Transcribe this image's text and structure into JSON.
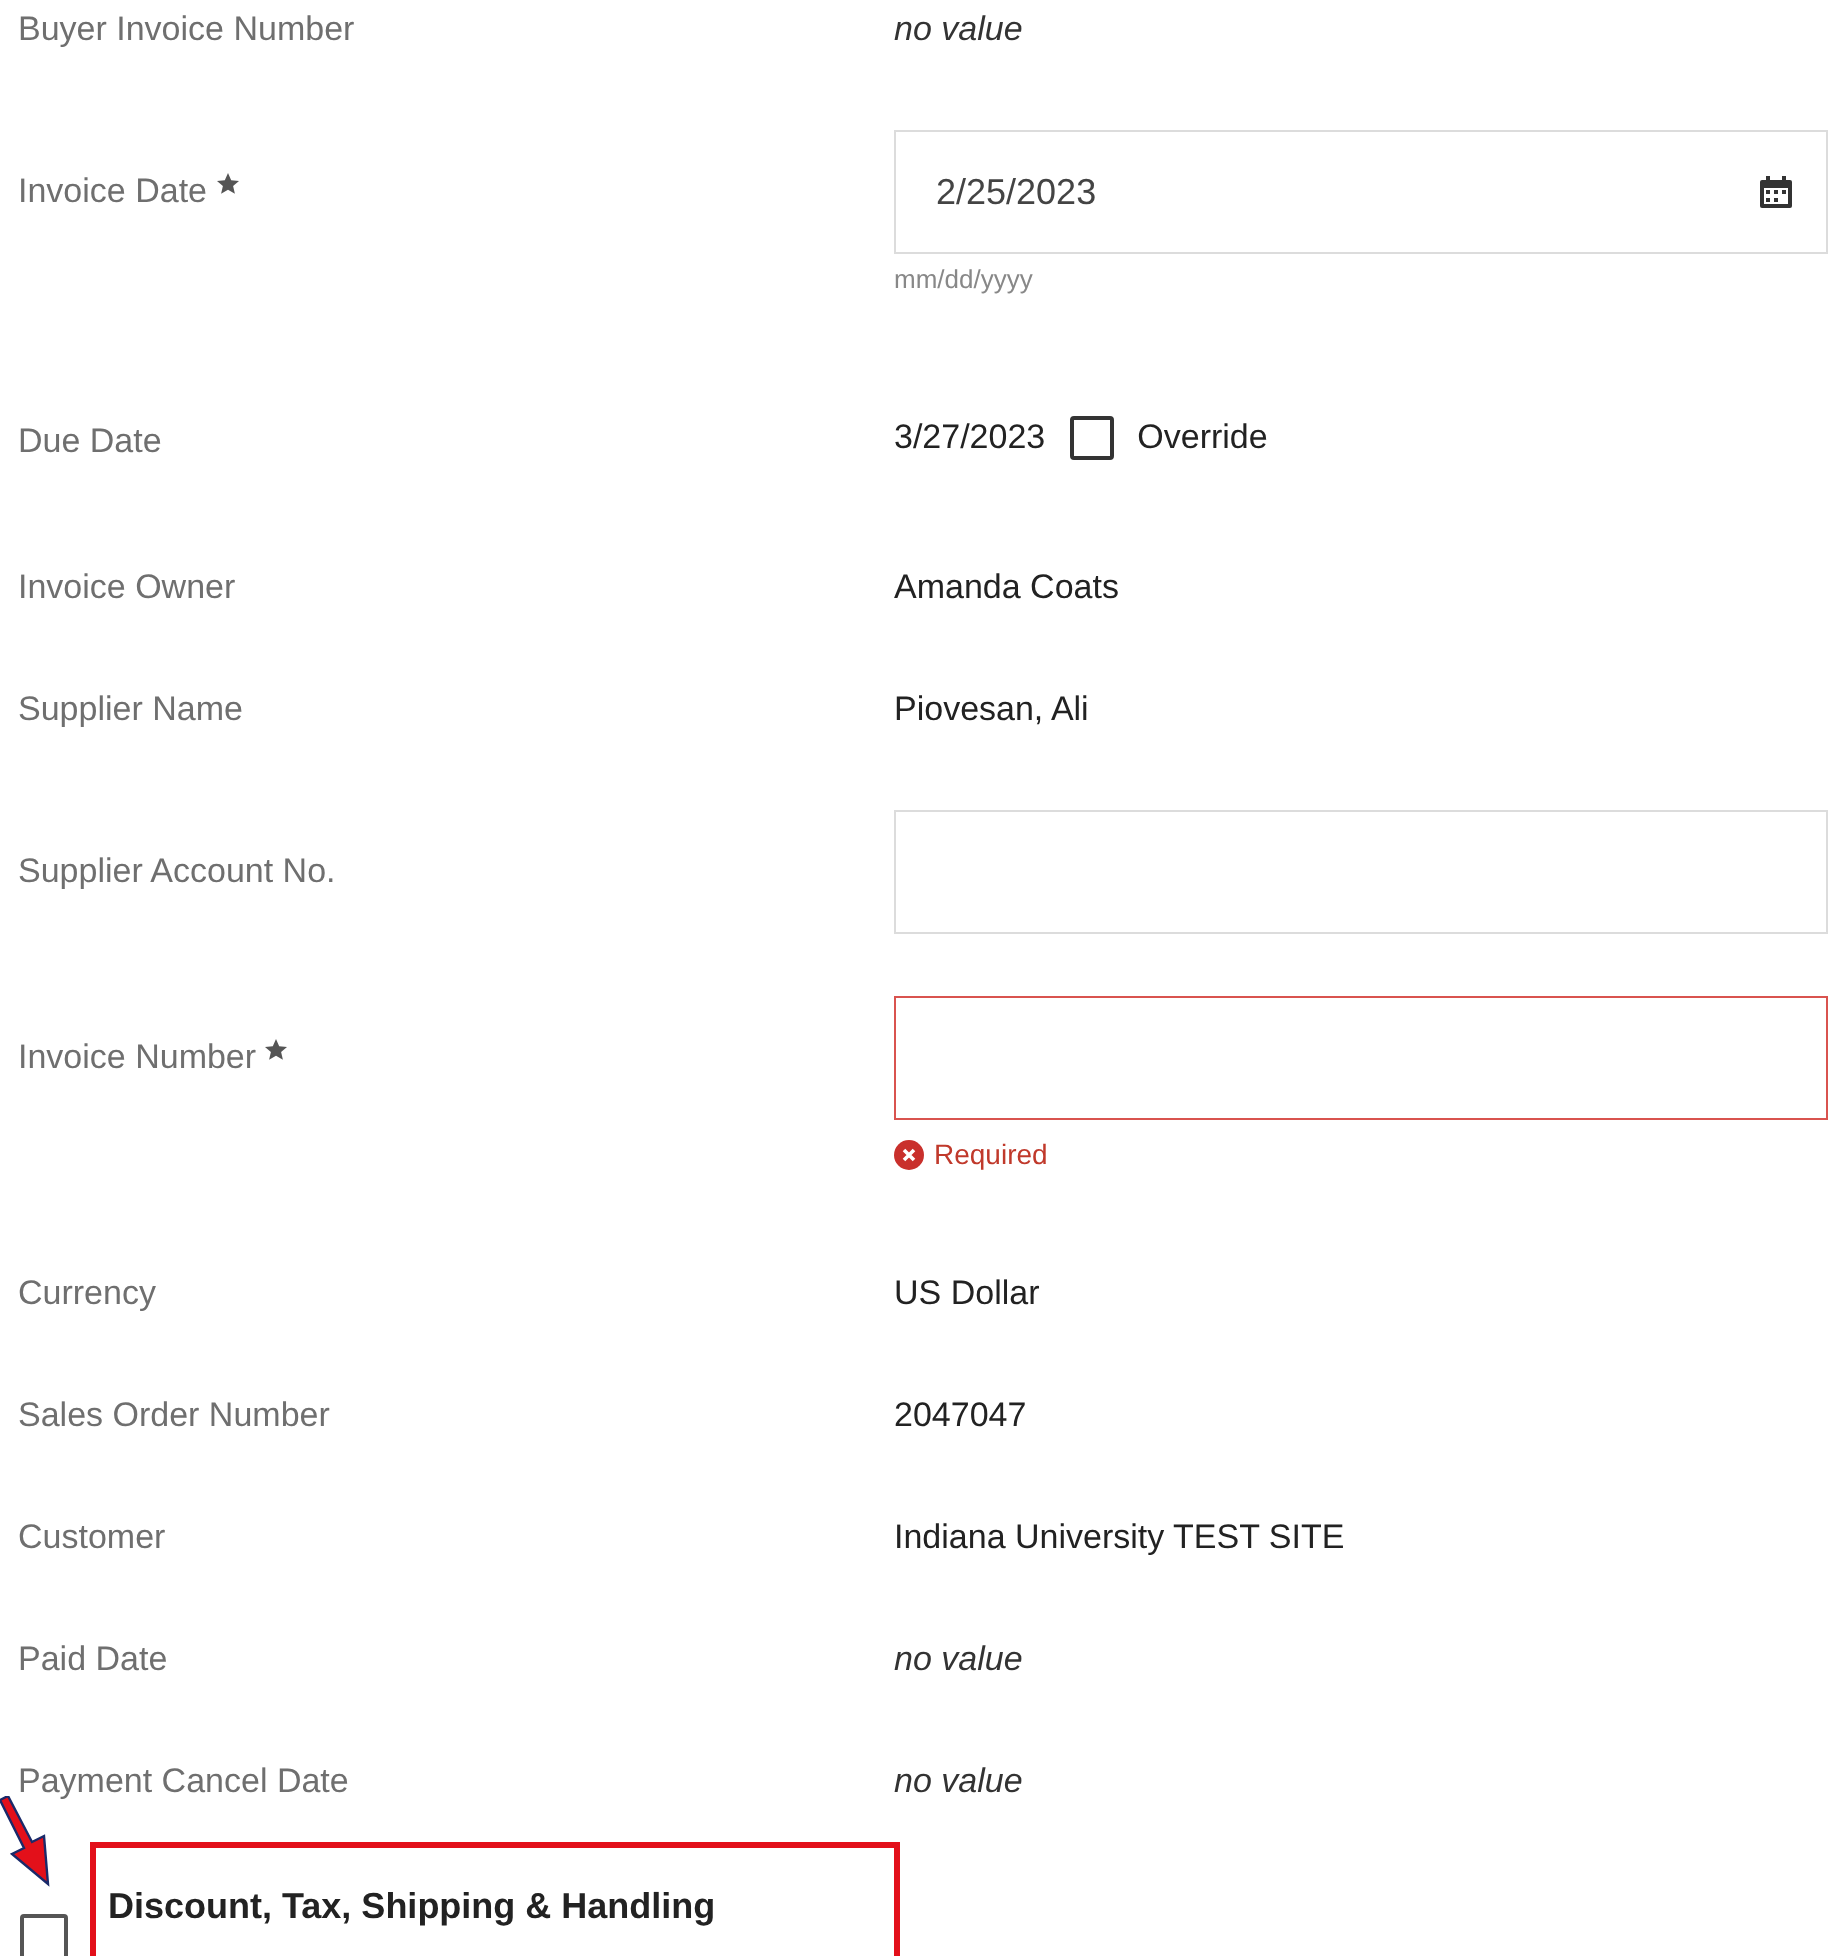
{
  "fields": [
    {
      "kind": "text",
      "label": "Buyer Invoice Number",
      "required": false,
      "value": "no value",
      "empty": true
    },
    {
      "kind": "date",
      "label": "Invoice Date",
      "required": true,
      "value": "2/25/2023",
      "hint": "mm/dd/yyyy"
    },
    {
      "kind": "due",
      "label": "Due Date",
      "required": false,
      "value": "3/27/2023",
      "override": {
        "label": "Override",
        "checked": false
      }
    },
    {
      "kind": "text",
      "label": "Invoice Owner",
      "required": false,
      "value": "Amanda Coats",
      "empty": false
    },
    {
      "kind": "text",
      "label": "Supplier Name",
      "required": false,
      "value": "Piovesan, Ali",
      "empty": false
    },
    {
      "kind": "input",
      "label": "Supplier Account No.",
      "required": false,
      "invalid": false
    },
    {
      "kind": "input",
      "label": "Invoice Number",
      "required": true,
      "invalid": true,
      "error": "Required"
    },
    {
      "kind": "text",
      "label": "Currency",
      "required": false,
      "value": "US Dollar",
      "empty": false
    },
    {
      "kind": "text",
      "label": "Sales Order Number",
      "required": false,
      "value": "2047047",
      "empty": false
    },
    {
      "kind": "text",
      "label": "Customer",
      "required": false,
      "value": "Indiana University TEST SITE",
      "empty": false
    },
    {
      "kind": "text",
      "label": "Paid Date",
      "required": false,
      "value": "no value",
      "empty": true
    },
    {
      "kind": "text",
      "label": "Payment Cancel Date",
      "required": false,
      "value": "no value",
      "empty": true
    }
  ],
  "section_toggle": {
    "label": "Discount, Tax, Shipping & Handling",
    "checked": false
  }
}
